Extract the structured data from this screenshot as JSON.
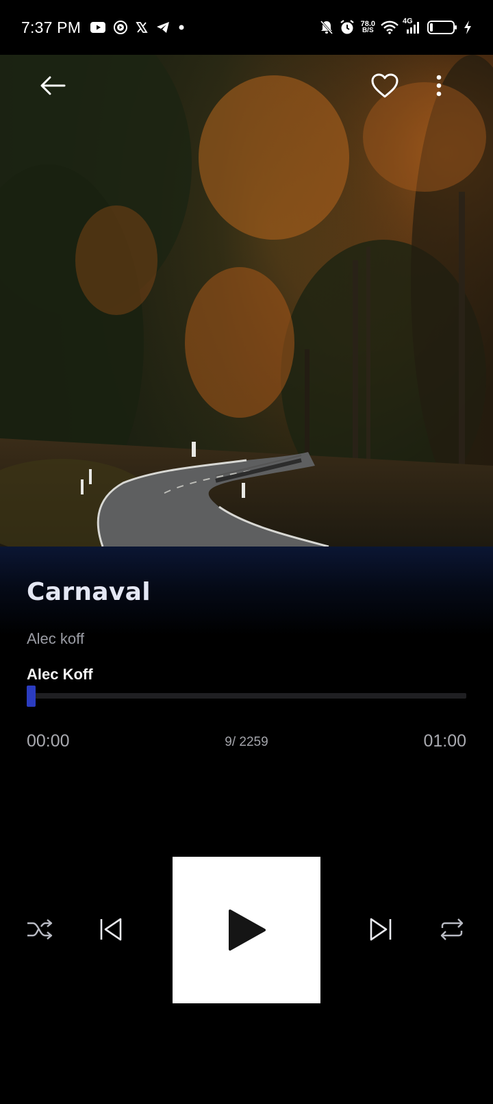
{
  "status_bar": {
    "time": "7:37 PM",
    "net_speed_value": "78.0",
    "net_speed_unit": "B/S",
    "network_type": "4G",
    "icons": [
      "youtube-icon",
      "youtube-music-icon",
      "x-icon",
      "telegram-icon",
      "dot-icon",
      "bell-muted-icon",
      "alarm-icon",
      "wifi-icon",
      "signal-icon",
      "battery-icon",
      "charging-bolt-icon"
    ]
  },
  "header": {
    "back_icon": "arrow-left-icon",
    "favorite_icon": "heart-outline-icon",
    "menu_icon": "more-vertical-icon"
  },
  "track": {
    "title": "Carnaval",
    "subtitle": "Alec koff",
    "artist": "Alec Koff"
  },
  "playback": {
    "elapsed": "00:00",
    "counter": "9/ 2259",
    "total": "01:00",
    "progress_fraction": 0.0
  },
  "controls": {
    "shuffle_icon": "shuffle-icon",
    "previous_icon": "skip-previous-icon",
    "play_icon": "play-icon",
    "next_icon": "skip-next-icon",
    "repeat_icon": "repeat-icon"
  },
  "colors": {
    "accent": "#2b3cc0",
    "background": "#000000",
    "title_text": "#e4e7f3"
  }
}
